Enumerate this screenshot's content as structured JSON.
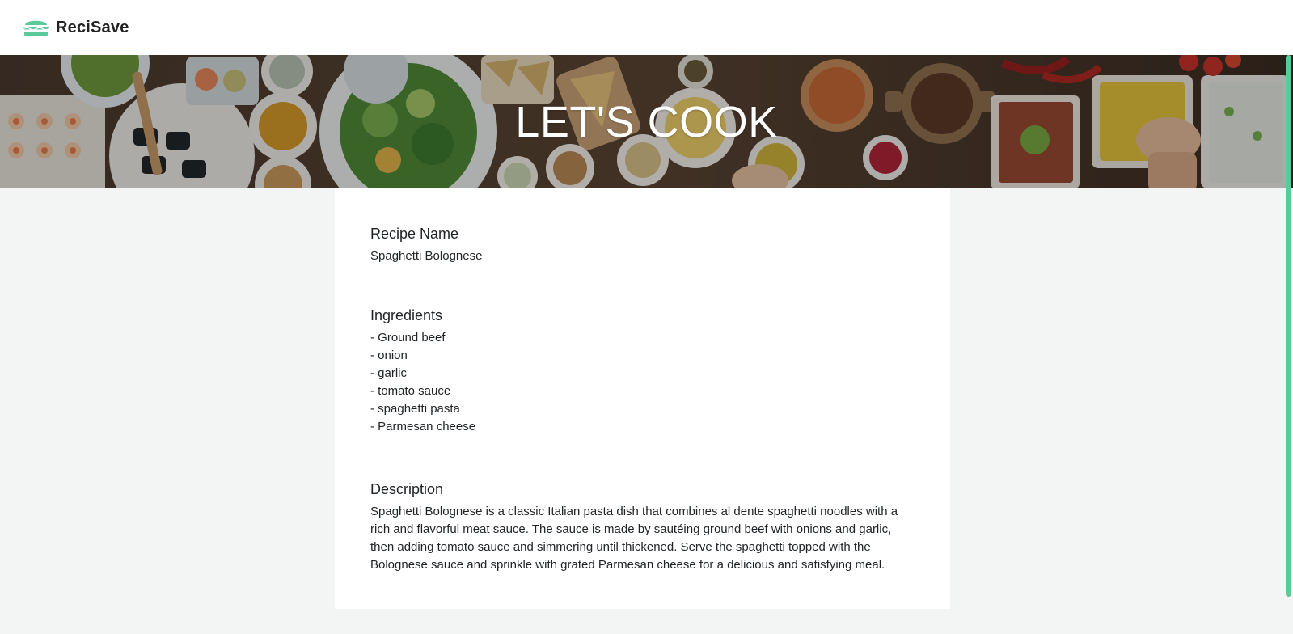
{
  "app": {
    "brand_name": "ReciSave",
    "accent_color": "#5cc99b",
    "logo_icon": "burger-icon"
  },
  "hero": {
    "title": "LET'S COOK",
    "background_image": "food-table-photo"
  },
  "recipe": {
    "name_heading": "Recipe Name",
    "name_value": "Spaghetti Bolognese",
    "ingredients_heading": "Ingredients",
    "ingredients": [
      "- Ground beef",
      "- onion",
      "- garlic",
      "- tomato sauce",
      "- spaghetti pasta",
      "- Parmesan cheese"
    ],
    "description_heading": "Description",
    "description": "Spaghetti Bolognese is a classic Italian pasta dish that combines al dente spaghetti noodles with a rich and flavorful meat sauce. The sauce is made by sautéing ground beef with onions and garlic, then adding tomato sauce and simmering until thickened. Serve the spaghetti topped with the Bolognese sauce and sprinkle with grated Parmesan cheese for a delicious and satisfying meal."
  }
}
